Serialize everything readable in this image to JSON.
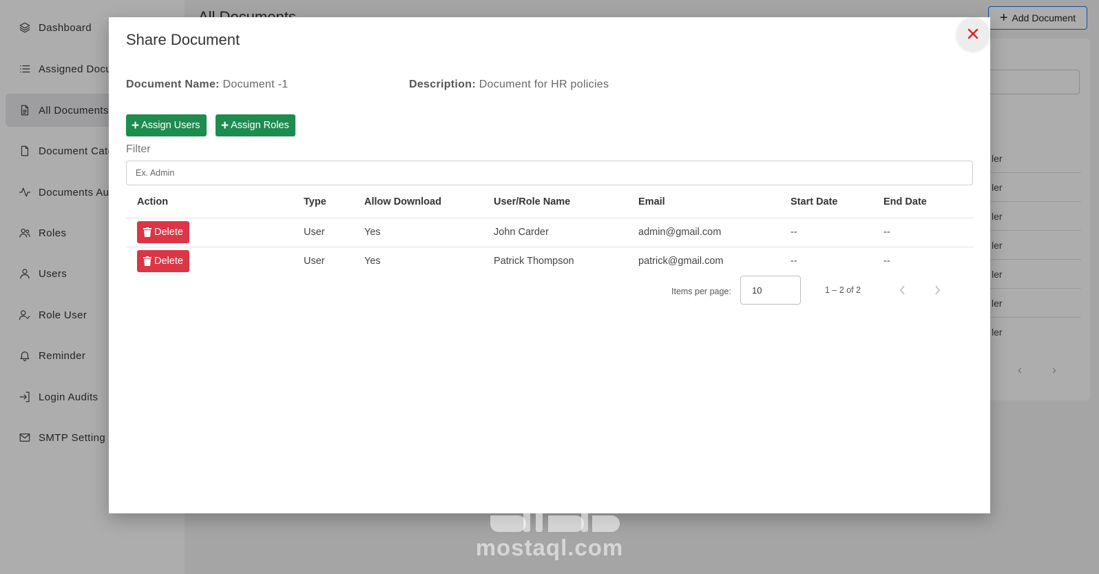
{
  "sidebar": {
    "items": [
      {
        "label": "Dashboard",
        "icon": "layers-icon"
      },
      {
        "label": "Assigned Documents",
        "icon": "list-icon"
      },
      {
        "label": "All Documents",
        "icon": "document-icon",
        "active": true
      },
      {
        "label": "Document Categories",
        "icon": "file-icon"
      },
      {
        "label": "Documents Audit Trail",
        "icon": "activity-icon"
      },
      {
        "label": "Roles",
        "icon": "users-icon"
      },
      {
        "label": "Users",
        "icon": "user-icon"
      },
      {
        "label": "Role User",
        "icon": "user-check-icon"
      },
      {
        "label": "Reminder",
        "icon": "bell-icon"
      },
      {
        "label": "Login Audits",
        "icon": "login-icon"
      },
      {
        "label": "SMTP Setting",
        "icon": "mail-icon"
      }
    ]
  },
  "background": {
    "page_title": "All Documents",
    "add_document_label": "Add Document",
    "row_fragment": "ler"
  },
  "modal": {
    "title": "Share Document",
    "document_name_label": "Document Name:",
    "document_name_value": "Document -1",
    "description_label": "Description:",
    "description_value": "Document for HR policies",
    "assign_users_label": "Assign Users",
    "assign_roles_label": "Assign Roles",
    "filter_label": "Filter",
    "filter_placeholder": "Ex. Admin",
    "table": {
      "headers": [
        "Action",
        "Type",
        "Allow Download",
        "User/Role Name",
        "Email",
        "Start Date",
        "End Date"
      ],
      "rows": [
        {
          "action": "Delete",
          "type": "User",
          "allow_download": "Yes",
          "name": "John Carder",
          "email": "admin@gmail.com",
          "start_date": "--",
          "end_date": "--"
        },
        {
          "action": "Delete",
          "type": "User",
          "allow_download": "Yes",
          "name": "Patrick Thompson",
          "email": "patrick@gmail.com",
          "start_date": "--",
          "end_date": "--"
        }
      ]
    },
    "paginator": {
      "items_per_page_label": "Items per page:",
      "items_per_page_value": "10",
      "range_label": "1 – 2 of 2"
    }
  },
  "watermark": {
    "text": "mostaql.com"
  },
  "colors": {
    "primary_green": "#1e8c4e",
    "danger_red": "#dc3545",
    "close_red": "#e0202a",
    "accent_blue": "#1a73e8"
  }
}
